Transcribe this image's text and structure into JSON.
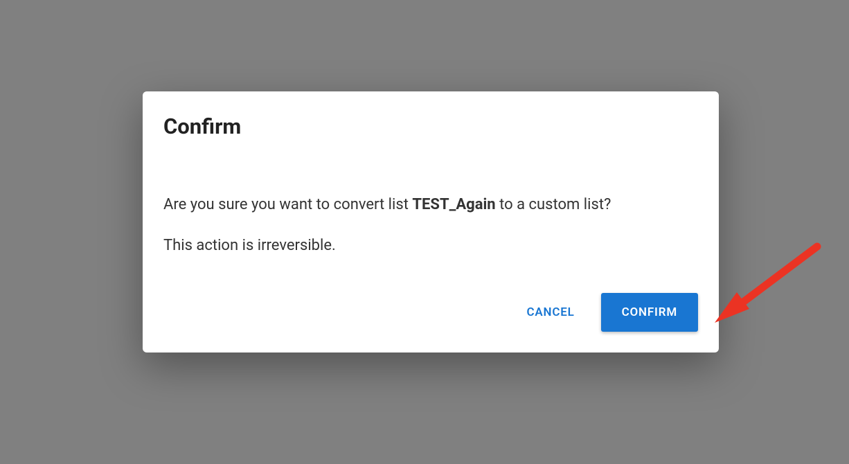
{
  "modal": {
    "title": "Confirm",
    "message_prefix": "Are you sure you want to convert list ",
    "list_name": "TEST_Again",
    "message_suffix": " to a custom list?",
    "warning": "This action is irreversible.",
    "cancel_label": "CANCEL",
    "confirm_label": "CONFIRM"
  },
  "colors": {
    "primary": "#1976d2",
    "overlay": "#808080",
    "annotation": "#eb3323"
  }
}
